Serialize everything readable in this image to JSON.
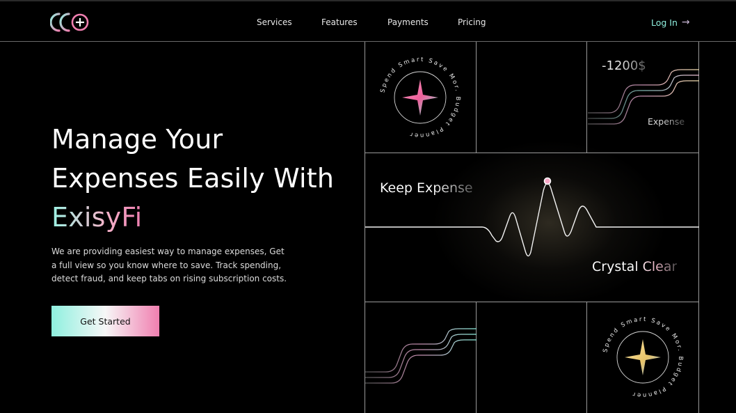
{
  "brand": {
    "logo_icon": "triple-circle-plus-logo"
  },
  "nav": {
    "items": [
      "Services",
      "Features",
      "Payments",
      "Pricing"
    ],
    "login_label": "Log In",
    "login_icon": "arrow-right-icon"
  },
  "hero": {
    "title_line1": "Manage Your",
    "title_line2": "Expenses Easily With",
    "title_accent": "ExisyFi",
    "description": "We are providing easiest way to manage expenses, Get a full view so you know where to save. Track spending, detect fraud, and keep tabs on rising subscription costs.",
    "cta_label": "Get Started"
  },
  "cards": {
    "seal_text": "Spend Smart Save Mor. Budget Planner",
    "expense_amount": "-1200$",
    "expense_label": "Expense",
    "keep_label": "Keep Expense",
    "crystal_label": "Crystal Clear"
  },
  "colors": {
    "accent_teal": "#8ff0df",
    "accent_pink": "#f07fb0",
    "background": "#000000"
  }
}
